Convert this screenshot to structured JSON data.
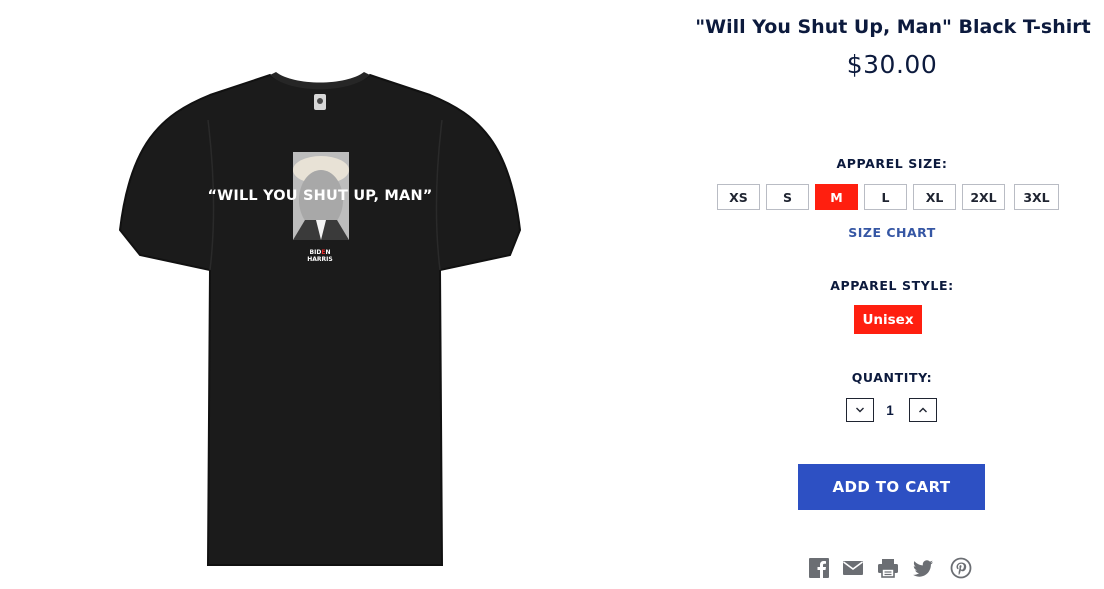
{
  "product": {
    "title": "\"Will You Shut Up, Man\" Black T-shirt",
    "price": "$30.00",
    "image": {
      "slogan": "“WILL YOU SHUT UP, MAN”",
      "logo_line1_a": "BID",
      "logo_line1_accent": "E",
      "logo_line1_b": "N",
      "logo_line2": "HARRIS",
      "shirt_color": "#1b1b1b"
    }
  },
  "options": {
    "size": {
      "label": "APPAREL SIZE:",
      "choices": [
        "XS",
        "S",
        "M",
        "L",
        "XL",
        "2XL",
        "3XL"
      ],
      "selected": "M",
      "size_chart_label": "SIZE CHART"
    },
    "style": {
      "label": "APPAREL STYLE:",
      "choices": [
        "Unisex"
      ],
      "selected": "Unisex"
    },
    "quantity": {
      "label": "QUANTITY:",
      "value": "1",
      "decrease_icon": "chevron-down-icon",
      "increase_icon": "chevron-up-icon"
    }
  },
  "cart": {
    "add_label": "ADD TO CART"
  },
  "share": {
    "icons": [
      "facebook-icon",
      "email-icon",
      "print-icon",
      "twitter-icon",
      "pinterest-icon"
    ]
  },
  "colors": {
    "navy": "#0c1a3d",
    "selected_red": "#ff1f0f",
    "cart_blue": "#2d50c3",
    "link_blue": "#3556a4",
    "icon_gray": "#6b6e73"
  }
}
